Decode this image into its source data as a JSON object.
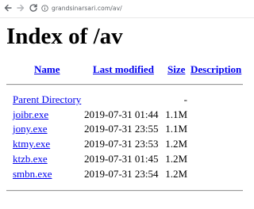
{
  "browser": {
    "url": "grandsinarsari.com/av/"
  },
  "page": {
    "title": "Index of /av",
    "columns": {
      "name": "Name",
      "last_modified": "Last modified",
      "size": "Size",
      "description": "Description"
    },
    "rows": [
      {
        "name": "Parent Directory",
        "modified": "",
        "size": "-"
      },
      {
        "name": "joibr.exe",
        "modified": "2019-07-31 01:44",
        "size": "1.1M"
      },
      {
        "name": "jony.exe",
        "modified": "2019-07-31 23:55",
        "size": "1.1M"
      },
      {
        "name": "ktmy.exe",
        "modified": "2019-07-31 23:53",
        "size": "1.2M"
      },
      {
        "name": "ktzb.exe",
        "modified": "2019-07-31 01:45",
        "size": "1.2M"
      },
      {
        "name": "smbn.exe",
        "modified": "2019-07-31 23:54",
        "size": "1.2M"
      }
    ]
  },
  "icons": {
    "back": "back-arrow-icon",
    "forward": "forward-arrow-icon",
    "reload": "reload-icon",
    "site_info": "info-icon"
  },
  "colors": {
    "link": "#0000ee",
    "text": "#000000",
    "url": "#5f6368"
  }
}
